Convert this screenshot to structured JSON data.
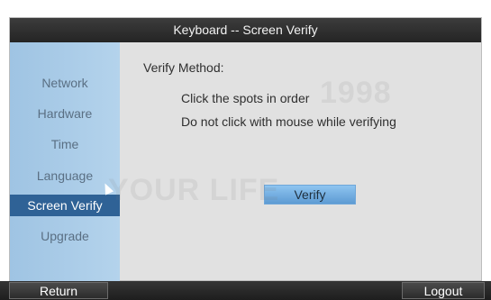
{
  "window": {
    "title": "Keyboard -- Screen Verify"
  },
  "sidebar": {
    "items": [
      {
        "label": "Network"
      },
      {
        "label": "Hardware"
      },
      {
        "label": "Time"
      },
      {
        "label": "Language"
      },
      {
        "label": "Screen Verify"
      },
      {
        "label": "Upgrade"
      }
    ],
    "active_index": 4
  },
  "main": {
    "verify_method_label": "Verify Method:",
    "instruction_1": "Click the spots in order",
    "instruction_2": "Do not click with mouse while verifying",
    "verify_button_label": "Verify"
  },
  "bottom_bar": {
    "return_label": "Return",
    "logout_label": "Logout"
  },
  "overlay": {
    "watermark_text": "YOUR LIFE",
    "watermark_number": "1998"
  },
  "colors": {
    "sidebar_active": "#2f6296",
    "titlebar_bg": "#2a2a2a",
    "button_blue": "#6da8dc"
  }
}
